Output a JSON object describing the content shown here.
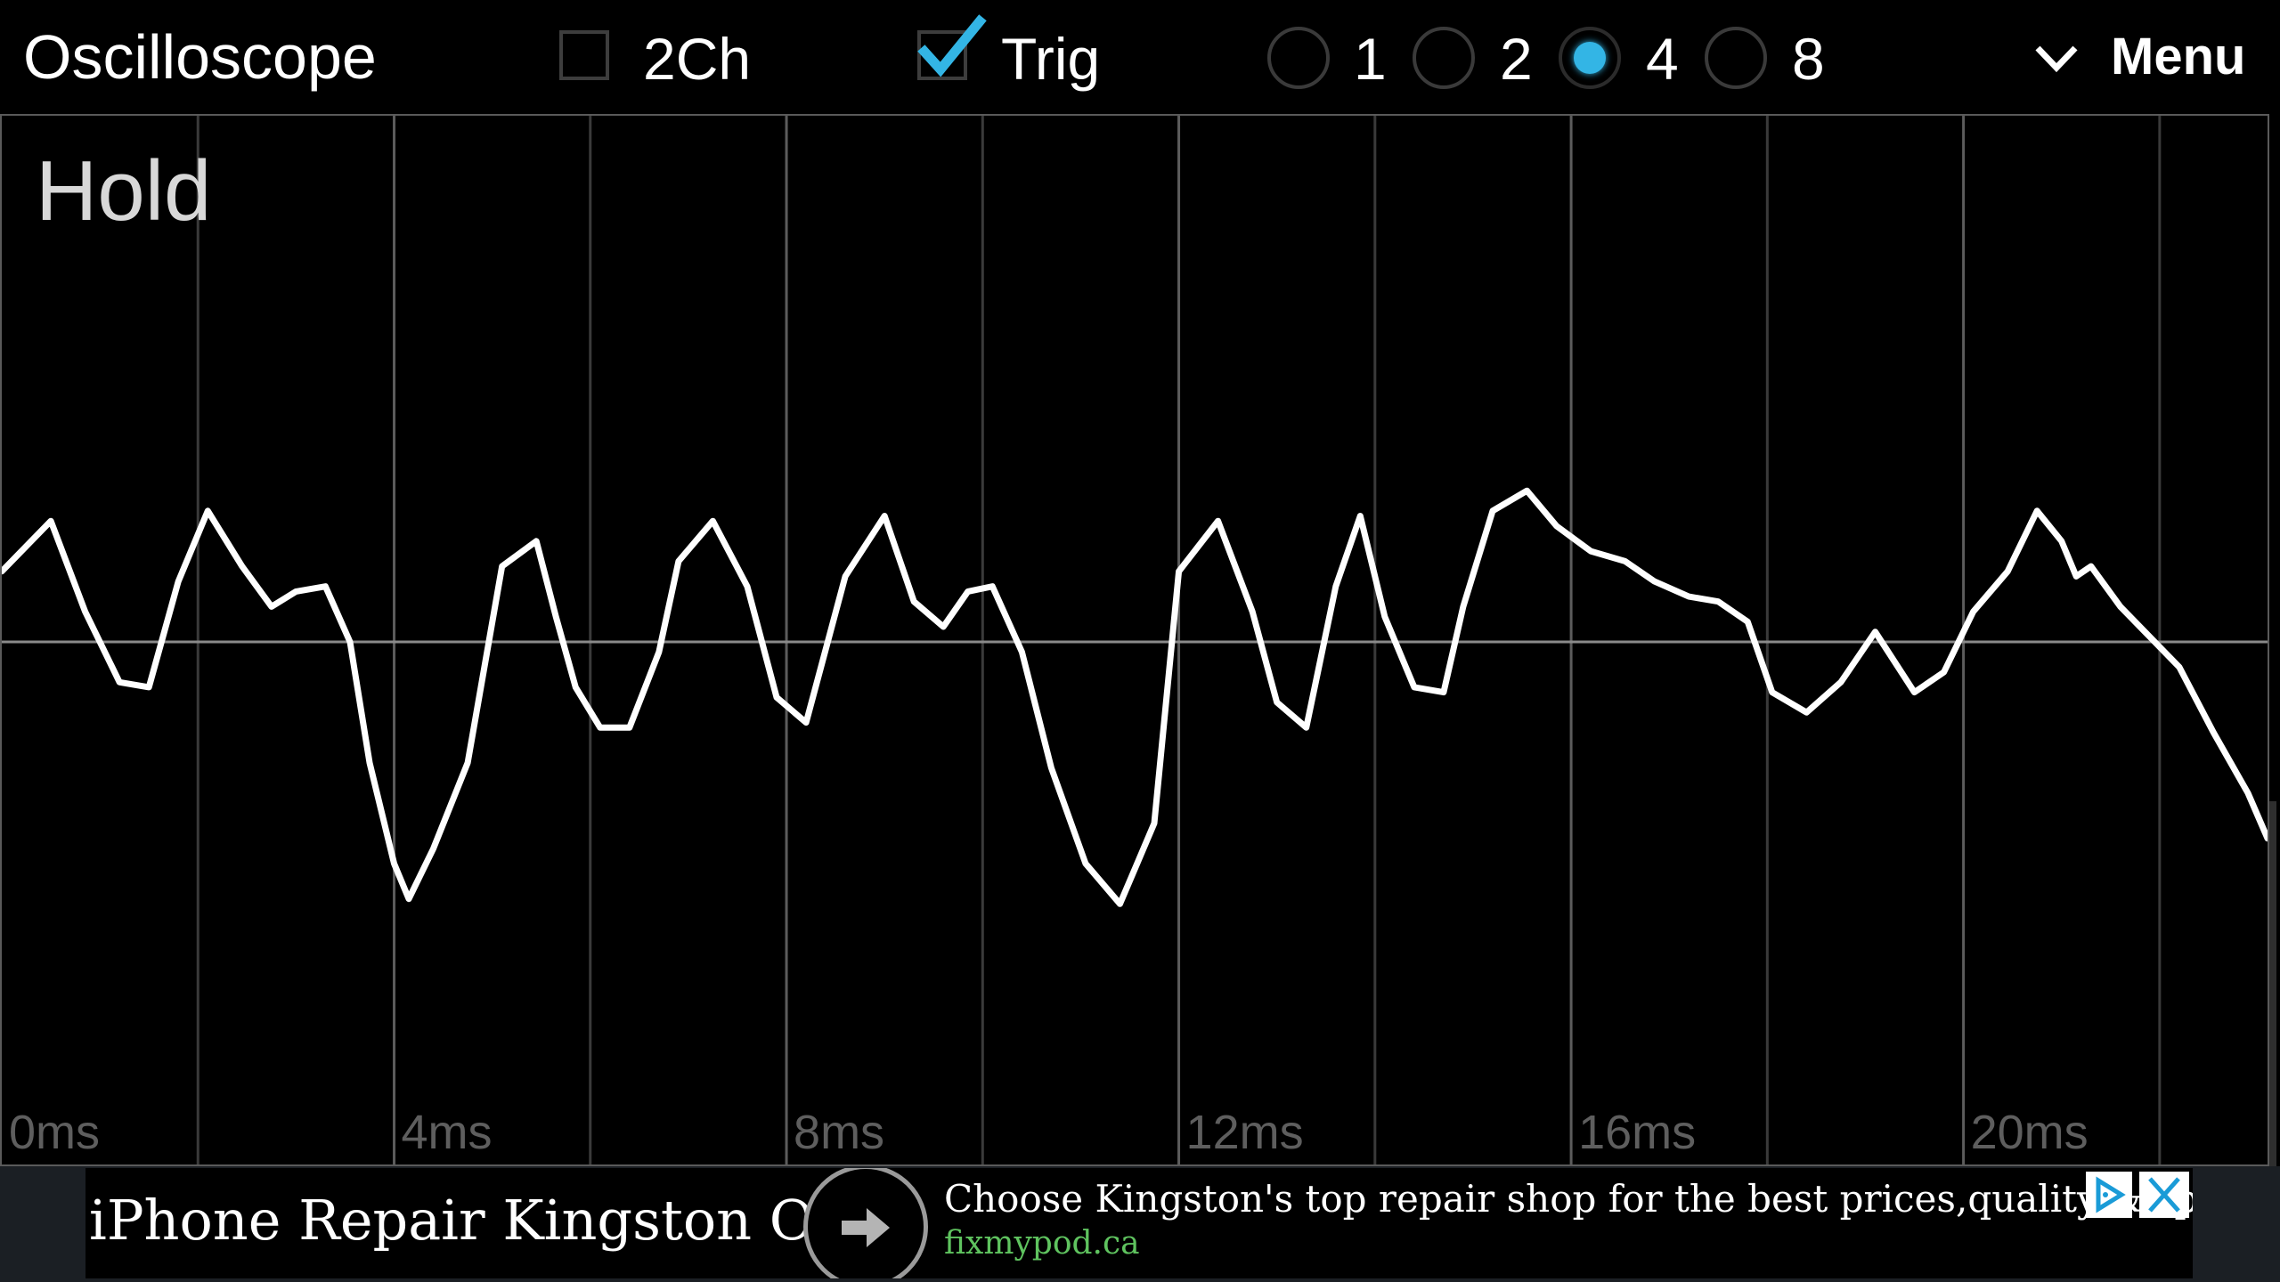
{
  "app": {
    "title": "Oscilloscope"
  },
  "controls": {
    "two_channel": {
      "label": "2Ch",
      "checked": false
    },
    "trigger": {
      "label": "Trig",
      "checked": true
    },
    "scale_options": [
      {
        "label": "1",
        "selected": false
      },
      {
        "label": "2",
        "selected": false
      },
      {
        "label": "4",
        "selected": true
      },
      {
        "label": "8",
        "selected": false
      }
    ],
    "menu_label": "Menu"
  },
  "scope": {
    "status": "Hold",
    "accent_color": "#33b5e5",
    "trace_color": "#ffffff"
  },
  "chart_data": {
    "type": "line",
    "title": "",
    "xlabel": "",
    "ylabel": "",
    "x_tick_labels": [
      "0ms",
      "4ms",
      "8ms",
      "12ms",
      "16ms",
      "20ms"
    ],
    "x_tick_values": [
      0,
      4,
      8,
      12,
      16,
      20
    ],
    "xlim": [
      0,
      23.1
    ],
    "ylim": [
      -1,
      1
    ],
    "grid": true,
    "series": [
      {
        "x": [
          0,
          0.5,
          0.85,
          1.2,
          1.5,
          1.8,
          2.1,
          2.45,
          2.75,
          3.0,
          3.3,
          3.55,
          3.75,
          4.0,
          4.15,
          4.4,
          4.75,
          5.1,
          5.45,
          5.65,
          5.85,
          6.1,
          6.4,
          6.7,
          6.9,
          7.25,
          7.6,
          7.9,
          8.2,
          8.6,
          9.0,
          9.3,
          9.6,
          9.85,
          10.1,
          10.4,
          10.7,
          11.05,
          11.4,
          11.75,
          12.0,
          12.4,
          12.75,
          13.0,
          13.3,
          13.6,
          13.85,
          14.1,
          14.4,
          14.7,
          14.9,
          15.2,
          15.55,
          15.85,
          16.2,
          16.55,
          16.85,
          17.2,
          17.5,
          17.8,
          18.05,
          18.4,
          18.75,
          19.1,
          19.5,
          19.8,
          20.1,
          20.45,
          20.75,
          21.0,
          21.15,
          21.3,
          21.6,
          21.85,
          22.2,
          22.55,
          22.9,
          23.1
        ],
        "y": [
          0.14,
          0.24,
          0.06,
          -0.08,
          -0.09,
          0.12,
          0.26,
          0.15,
          0.07,
          0.1,
          0.11,
          0.0,
          -0.24,
          -0.44,
          -0.51,
          -0.41,
          -0.24,
          0.15,
          0.2,
          0.05,
          -0.09,
          -0.17,
          -0.17,
          -0.02,
          0.16,
          0.24,
          0.11,
          -0.11,
          -0.16,
          0.13,
          0.25,
          0.08,
          0.03,
          0.1,
          0.11,
          -0.02,
          -0.25,
          -0.44,
          -0.52,
          -0.36,
          0.14,
          0.24,
          0.06,
          -0.12,
          -0.17,
          0.11,
          0.25,
          0.05,
          -0.09,
          -0.1,
          0.07,
          0.26,
          0.3,
          0.23,
          0.18,
          0.16,
          0.12,
          0.09,
          0.08,
          0.04,
          -0.1,
          -0.14,
          -0.08,
          0.02,
          -0.1,
          -0.06,
          0.06,
          0.14,
          0.26,
          0.2,
          0.13,
          0.15,
          0.07,
          0.02,
          -0.05,
          -0.18,
          -0.3,
          -0.39
        ]
      }
    ]
  },
  "ad": {
    "headline": "iPhone Repair Kingston ON",
    "text": "Choose Kingston's top repair shop for the best prices,quality & speed",
    "url": "fixmypod.ca",
    "arrow_icon": "arrow-right-icon",
    "choices_icon": "ad-choices-icon",
    "close_icon": "close-icon"
  }
}
